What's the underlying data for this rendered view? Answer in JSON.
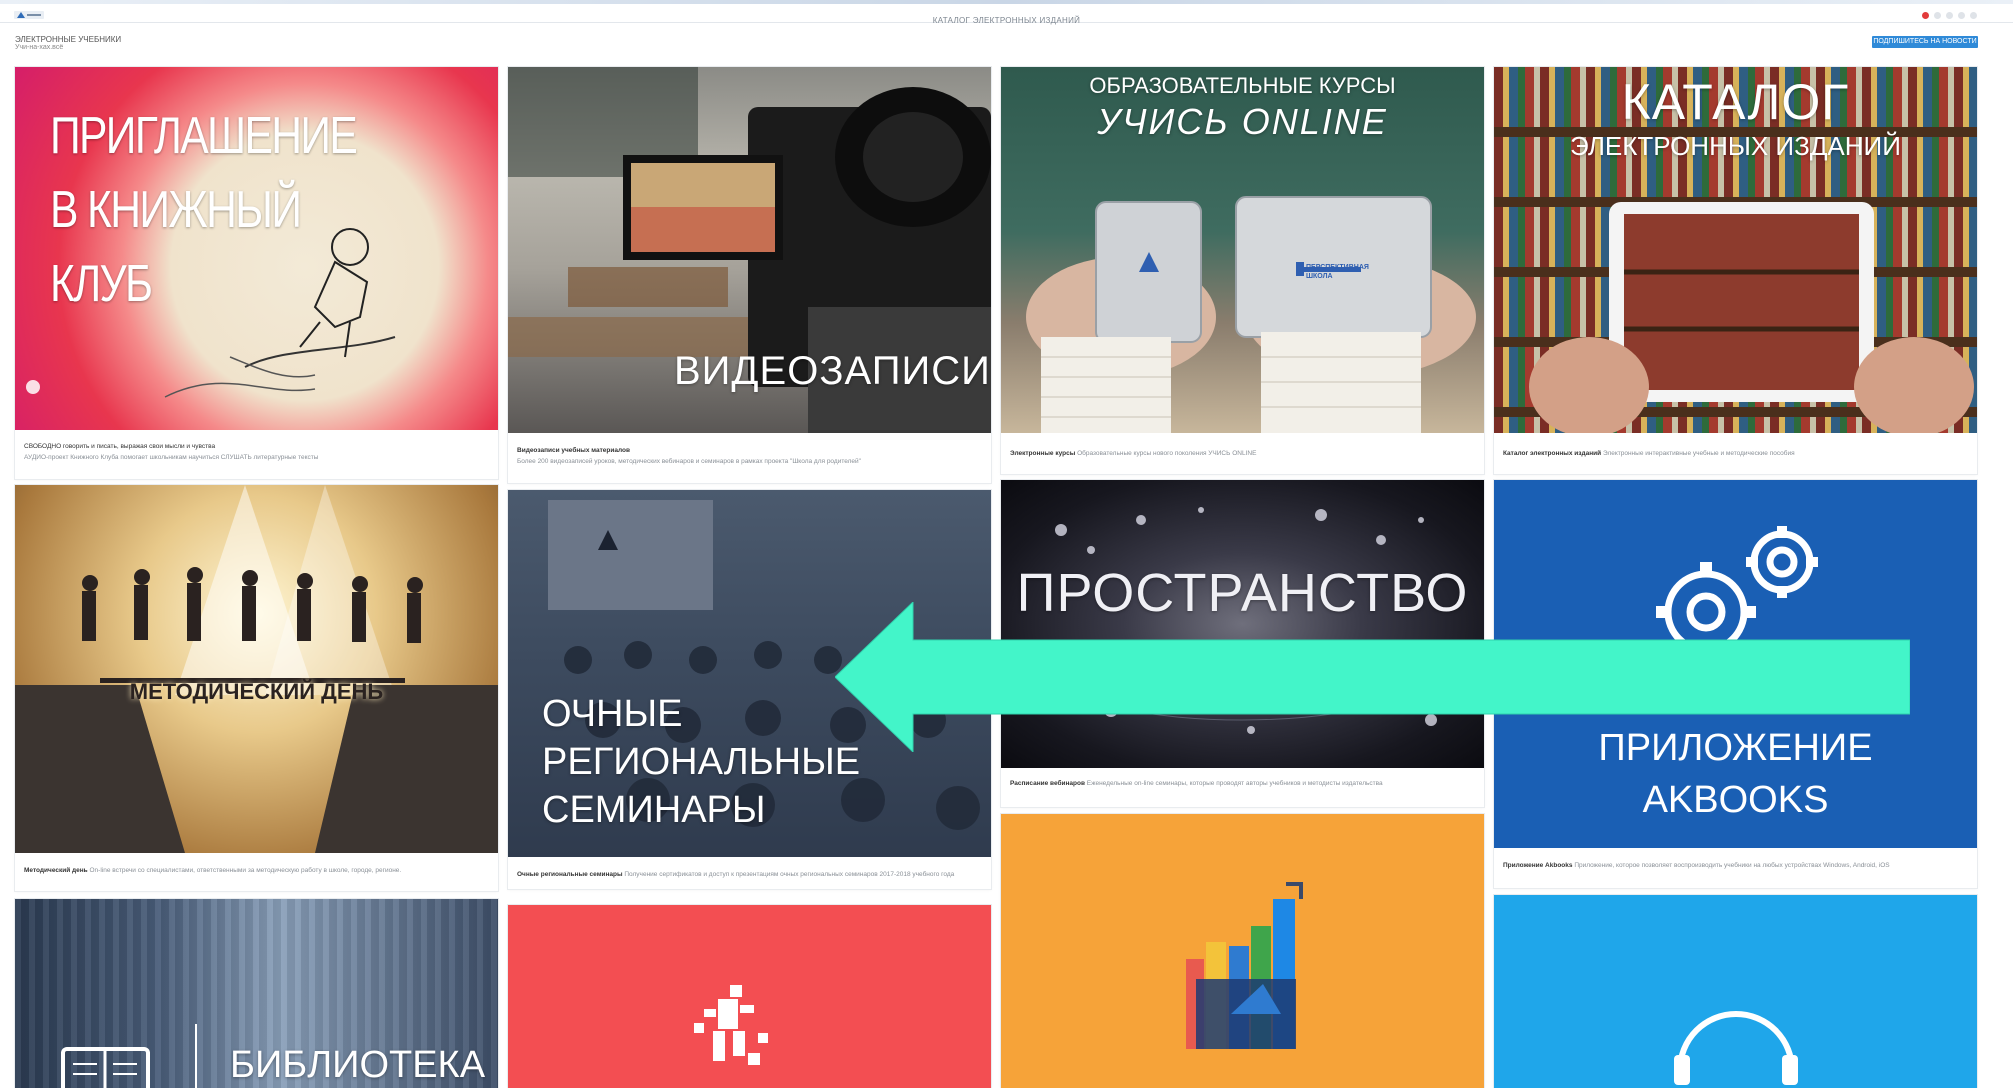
{
  "header": {
    "nav_text": "КАТАЛОГ ЭЛЕКТРОННЫХ ИЗДАНИЙ",
    "flags": [
      "ru",
      "en",
      "kz",
      "de",
      "fr"
    ],
    "section_title": "ЭЛЕКТРОННЫЕ УЧЕБНИКИ",
    "section_subtitle": "Учи-на-хах.всё",
    "subscribe_label": "ПОДПИШИТЕСЬ НА НОВОСТИ"
  },
  "cards": [
    {
      "title_lines": [
        "ПРИГЛАШЕНИЕ",
        "В КНИЖНЫЙ",
        "КЛУБ"
      ],
      "caption_line1": "СВОБОДНО говорить и писать, выражая свои мысли и чувства",
      "caption_line2": "АУДИО-проект Книжного Клуба помогает школьникам научиться СЛУШАТЬ литературные тексты"
    },
    {
      "overlay_text": "ВИДЕОЗАПИСИ",
      "caption_bold": "Видеозаписи учебных материалов",
      "caption_line2": "Более 200 видеозаписей уроков, методических вебинаров и семинаров в рамках проекта \"Школа для родителей\""
    },
    {
      "overlay_top": "ОБРАЗОВАТЕЛЬНЫЕ КУРСЫ",
      "overlay_script": "УЧИСЬ ONLINE",
      "tablet_brand": "ПЕРСПЕКТИВНАЯ ШКОЛА",
      "caption_bold": "Электронные курсы",
      "caption_text": "Образовательные курсы нового поколения УЧИСЬ ONLINE"
    },
    {
      "overlay_title": "КАТАЛОГ",
      "overlay_subtitle": "ЭЛЕКТРОННЫХ ИЗДАНИЙ",
      "caption_bold": "Каталог электронных изданий",
      "caption_text": "Электронные интерактивные учебные и методические пособия"
    },
    {
      "overlay_text": "МЕТОДИЧЕСКИЙ ДЕНЬ",
      "caption_bold": "Методический день",
      "caption_text": "On-line встречи со специалистами, ответственными за методическую работу в школе, городе, регионе."
    },
    {
      "overlay_lines": [
        "ОЧНЫЕ",
        "РЕГИОНАЛЬНЫЕ",
        "СЕМИНАРЫ"
      ],
      "caption_bold": "Очные региональные семинары",
      "caption_text": "Получение сертификатов и доступ к презентациям очных региональных семинаров 2017-2018 учебного года"
    },
    {
      "overlay_text": "ПРОСТРАНСТВО",
      "caption_bold": "Расписание вебинаров",
      "caption_text": "Еженедельные on-line семинары, которые проводят авторы учебников и методисты издательства"
    },
    {
      "overlay_lines": [
        "ПРИЛОЖЕНИЕ",
        "AKBOOKS"
      ],
      "caption_bold": "Приложение Akbooks",
      "caption_text": "Приложение, которое позволяет воспроизводить учебники на любых устройствах Windows, Android, iOS"
    },
    {
      "overlay_text": "БИБЛИОТЕКА"
    },
    {
      "overlay_text": ""
    },
    {
      "overlay_text": ""
    },
    {
      "overlay_text": ""
    }
  ],
  "colors": {
    "accent_arrow": "#43f5c9",
    "card_red": "#f34e52",
    "card_orange": "#f6a339",
    "card_blue_dark": "#1a5fb4",
    "card_blue_light": "#1fa6ea",
    "subscribe_btn": "#2f8ad8"
  }
}
